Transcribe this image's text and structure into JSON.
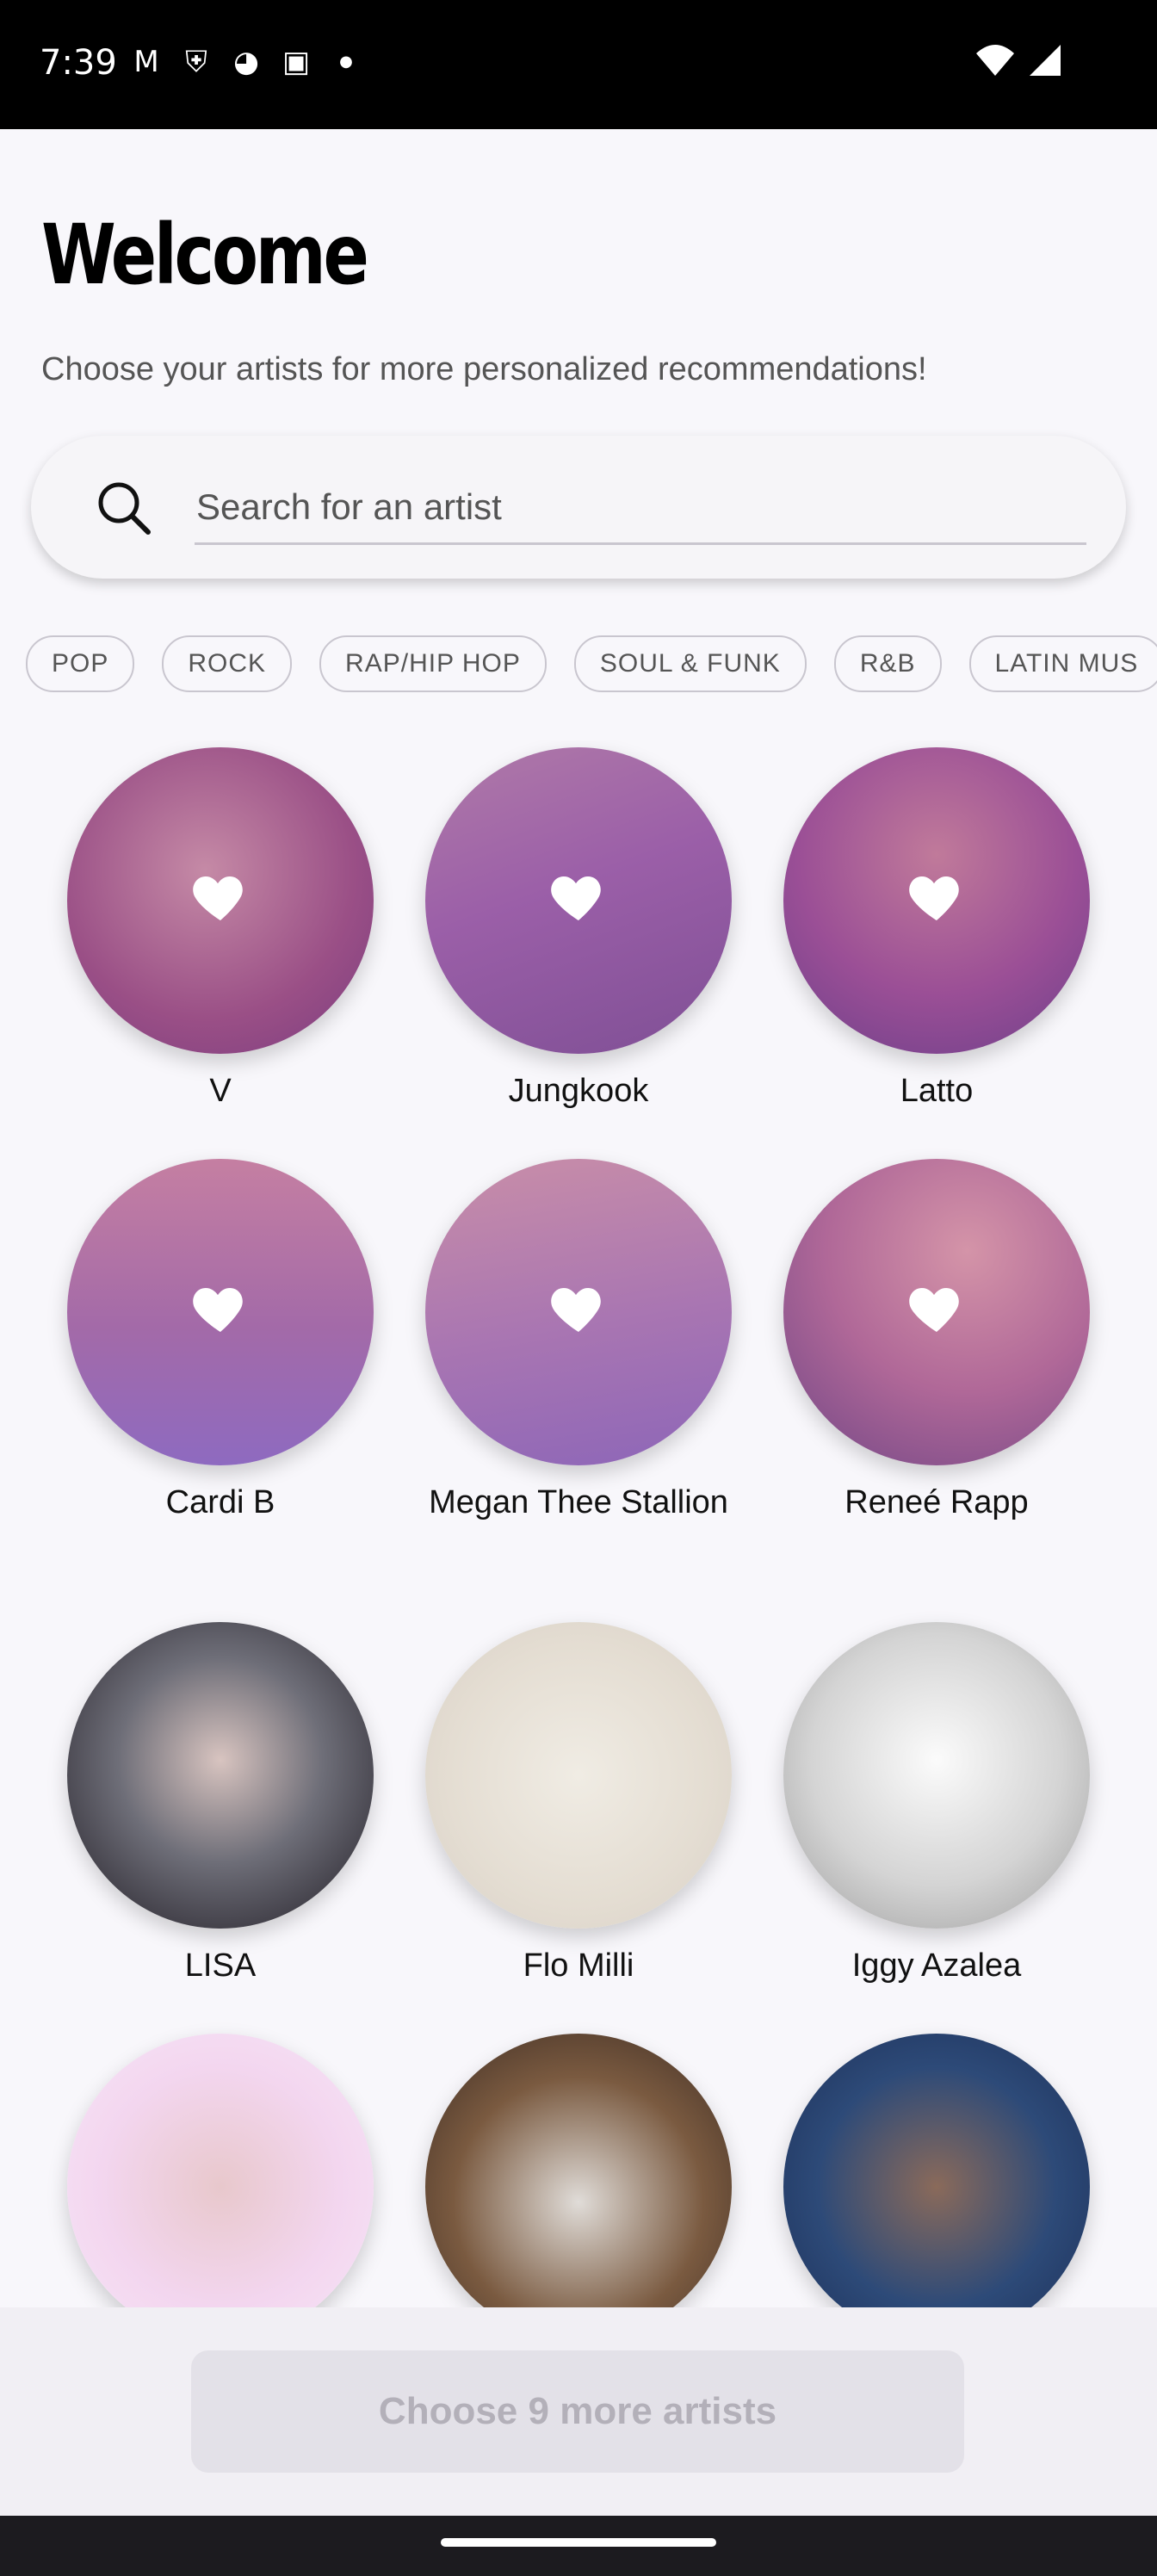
{
  "status_bar": {
    "time": "7:39",
    "icons": [
      "gmail-icon",
      "shield-icon",
      "sync-icon",
      "font-icon",
      "dot-icon"
    ],
    "right_icons": [
      "wifi-icon",
      "signal-icon"
    ]
  },
  "header": {
    "title": "Welcome",
    "subtitle": "Choose your artists for more personalized recommendations!"
  },
  "search": {
    "placeholder": "Search for an artist",
    "value": ""
  },
  "genres": [
    "POP",
    "ROCK",
    "RAP/HIP HOP",
    "SOUL & FUNK",
    "R&B",
    "LATIN MUS"
  ],
  "artists": [
    {
      "name": "V",
      "selected": true
    },
    {
      "name": "Jungkook",
      "selected": true
    },
    {
      "name": "Latto",
      "selected": true
    },
    {
      "name": "Cardi B",
      "selected": true
    },
    {
      "name": "Megan Thee Stallion",
      "selected": true
    },
    {
      "name": "Reneé Rapp",
      "selected": true
    },
    {
      "name": "LISA",
      "selected": false
    },
    {
      "name": "Flo Milli",
      "selected": false
    },
    {
      "name": "Iggy Azalea",
      "selected": false
    },
    {
      "name": "",
      "selected": false
    },
    {
      "name": "",
      "selected": false
    },
    {
      "name": "",
      "selected": false
    }
  ],
  "footer": {
    "button_label": "Choose 9 more artists"
  },
  "colors": {
    "selected_overlay": "#9b5fa8",
    "background": "#f8f7fb",
    "button_disabled": "#e3e1e8"
  }
}
